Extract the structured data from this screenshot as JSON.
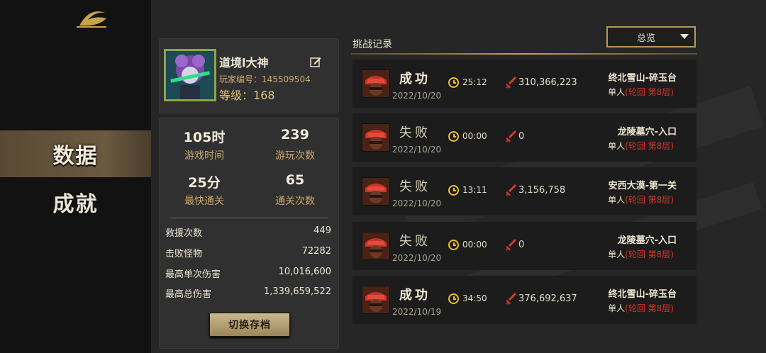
{
  "nav": {
    "items": [
      {
        "label": "数据",
        "active": true
      },
      {
        "label": "成就",
        "active": false
      }
    ]
  },
  "profile": {
    "name": "道境l大神",
    "id_label": "玩家编号：145509504",
    "level_label": "等级：",
    "level_value": "168"
  },
  "stats": {
    "big": [
      {
        "value": "105时",
        "label": "游戏时间"
      },
      {
        "value": "239",
        "label": "游玩次数"
      },
      {
        "value": "25分",
        "label": "最快通关"
      },
      {
        "value": "65",
        "label": "通关次数"
      }
    ],
    "rows": [
      {
        "label": "救援次数",
        "value": "449"
      },
      {
        "label": "击败怪物",
        "value": "72282"
      },
      {
        "label": "最高单次伤害",
        "value": "10,016,600"
      },
      {
        "label": "最高总伤害",
        "value": "1,339,659,522"
      }
    ],
    "switch_button": "切换存档"
  },
  "records": {
    "title": "挑战记录",
    "filter": "总览",
    "items": [
      {
        "result": "成功",
        "win": true,
        "date": "2022/10/20",
        "time": "25:12",
        "damage": "310,366,223",
        "stage": "终北雪山-碎玉台",
        "mode": "单人",
        "difficulty": "(轮回 第8层)"
      },
      {
        "result": "失败",
        "win": false,
        "date": "2022/10/20",
        "time": "00:00",
        "damage": "0",
        "stage": "龙陵墓穴-入口",
        "mode": "单人",
        "difficulty": "(轮回 第8层)"
      },
      {
        "result": "失败",
        "win": false,
        "date": "2022/10/20",
        "time": "13:11",
        "damage": "3,156,758",
        "stage": "安西大漠-第一关",
        "mode": "单人",
        "difficulty": "(轮回 第8层)"
      },
      {
        "result": "失败",
        "win": false,
        "date": "2022/10/20",
        "time": "00:00",
        "damage": "0",
        "stage": "龙陵墓穴-入口",
        "mode": "单人",
        "difficulty": "(轮回 第8层)"
      },
      {
        "result": "成功",
        "win": true,
        "date": "2022/10/19",
        "time": "34:50",
        "damage": "376,692,637",
        "stage": "终北雪山-碎玉台",
        "mode": "单人",
        "difficulty": "(轮回 第8层)"
      }
    ]
  },
  "colors": {
    "accent_gold": "#c9a96c",
    "difficulty_red": "#d8352a",
    "clock_yellow": "#f0c020"
  }
}
